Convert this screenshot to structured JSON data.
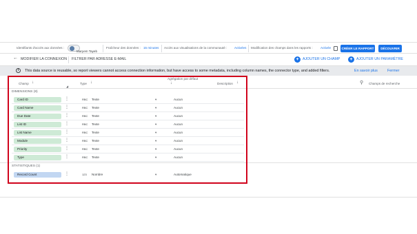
{
  "topbar": {
    "access_label": "Identifiants d'accès aux données :",
    "user_name": "Maryem Tayeb",
    "freshness_label": "Fraîcheur des données :",
    "freshness_value": "15 minutes",
    "community_label": "Accès aux visualisations de la communauté :",
    "community_value": "Activées",
    "edit_fields_label": "Modification des champs dans les rapports :",
    "edit_fields_value": "Activée",
    "create_report": "CRÉER LE RAPPORT",
    "explore": "DÉCOUVRIR"
  },
  "nav": {
    "back_icon": "arrow-left-icon",
    "modify_connection": "MODIFIER LA CONNEXION",
    "filter_email": "FILTRER PAR ADRESSE E-MAIL",
    "add_field": "AJOUTER UN CHAMP",
    "add_param": "AJOUTER UN PARAMÈTRE"
  },
  "info": {
    "message": "This data source is reusable, so report viewers cannot access connection information, but have access to some metadata, including column names, the connector type, and added filters.",
    "learn_more": "En savoir plus",
    "close": "Fermer"
  },
  "table": {
    "headers": {
      "field": "Champ",
      "type": "Type",
      "aggregation": "Agrégation par défaut",
      "description": "Description",
      "search_placeholder": "Champs de recherche"
    },
    "dimensions_label": "DIMENSIONS (8)",
    "dimensions": [
      {
        "name": "Card ID",
        "type_icon": "RBC",
        "type": "Texte",
        "aggregation": "Aucun"
      },
      {
        "name": "Card Name",
        "type_icon": "RBC",
        "type": "Texte",
        "aggregation": "Aucun"
      },
      {
        "name": "Due Date",
        "type_icon": "RBC",
        "type": "Texte",
        "aggregation": "Aucun"
      },
      {
        "name": "List ID",
        "type_icon": "RBC",
        "type": "Texte",
        "aggregation": "Aucun"
      },
      {
        "name": "List Name",
        "type_icon": "RBC",
        "type": "Texte",
        "aggregation": "Aucun"
      },
      {
        "name": "Module",
        "type_icon": "RBC",
        "type": "Texte",
        "aggregation": "Aucun"
      },
      {
        "name": "Priority",
        "type_icon": "RBC",
        "type": "Texte",
        "aggregation": "Aucun"
      },
      {
        "name": "Type",
        "type_icon": "RBC",
        "type": "Texte",
        "aggregation": "Aucun"
      }
    ],
    "metrics_label": "STATISTIQUES (1)",
    "metrics": [
      {
        "name": "Record Count",
        "type_icon": "123",
        "type": "Nombre",
        "aggregation": "Automatique"
      }
    ]
  },
  "colors": {
    "accent": "#1a73e8",
    "dimension_pill": "#ceead6",
    "metric_pill": "#c2d7f2",
    "highlight": "#d0021b"
  }
}
